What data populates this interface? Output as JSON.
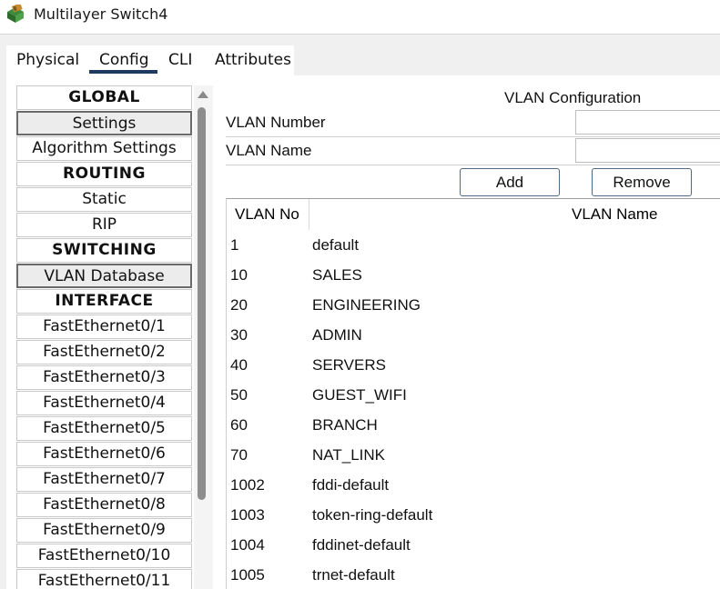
{
  "window": {
    "title": "Multilayer Switch4",
    "icon": "multilayer-switch-icon"
  },
  "tabs": [
    {
      "label": "Physical"
    },
    {
      "label": "Config",
      "active": true
    },
    {
      "label": "CLI"
    },
    {
      "label": "Attributes"
    }
  ],
  "sidebar": {
    "items": [
      {
        "label": "GLOBAL",
        "type": "header"
      },
      {
        "label": "Settings",
        "type": "item",
        "selected": true
      },
      {
        "label": "Algorithm Settings",
        "type": "item"
      },
      {
        "label": "ROUTING",
        "type": "header"
      },
      {
        "label": "Static",
        "type": "item"
      },
      {
        "label": "RIP",
        "type": "item"
      },
      {
        "label": "SWITCHING",
        "type": "header"
      },
      {
        "label": "VLAN Database",
        "type": "item",
        "selected": true
      },
      {
        "label": "INTERFACE",
        "type": "header"
      },
      {
        "label": "FastEthernet0/1",
        "type": "item"
      },
      {
        "label": "FastEthernet0/2",
        "type": "item"
      },
      {
        "label": "FastEthernet0/3",
        "type": "item"
      },
      {
        "label": "FastEthernet0/4",
        "type": "item"
      },
      {
        "label": "FastEthernet0/5",
        "type": "item"
      },
      {
        "label": "FastEthernet0/6",
        "type": "item"
      },
      {
        "label": "FastEthernet0/7",
        "type": "item"
      },
      {
        "label": "FastEthernet0/8",
        "type": "item"
      },
      {
        "label": "FastEthernet0/9",
        "type": "item"
      },
      {
        "label": "FastEthernet0/10",
        "type": "item"
      },
      {
        "label": "FastEthernet0/11",
        "type": "item"
      }
    ]
  },
  "vlan_config": {
    "title": "VLAN Configuration",
    "number_label": "VLAN Number",
    "number_value": "",
    "name_label": "VLAN Name",
    "name_value": "",
    "add_label": "Add",
    "remove_label": "Remove"
  },
  "vlan_table": {
    "headers": {
      "no": "VLAN No",
      "name": "VLAN Name"
    },
    "rows": [
      {
        "no": "1",
        "name": "default"
      },
      {
        "no": "10",
        "name": "SALES"
      },
      {
        "no": "20",
        "name": "ENGINEERING"
      },
      {
        "no": "30",
        "name": "ADMIN"
      },
      {
        "no": "40",
        "name": "SERVERS"
      },
      {
        "no": "50",
        "name": "GUEST_WIFI"
      },
      {
        "no": "60",
        "name": "BRANCH"
      },
      {
        "no": "70",
        "name": "NAT_LINK"
      },
      {
        "no": "1002",
        "name": "fddi-default"
      },
      {
        "no": "1003",
        "name": "token-ring-default"
      },
      {
        "no": "1004",
        "name": "fddinet-default"
      },
      {
        "no": "1005",
        "name": "trnet-default"
      }
    ]
  },
  "colors": {
    "tab_underline": "#1c3b5e",
    "button_border": "#4d6a86",
    "scroll_thumb": "#8d8d8d"
  }
}
